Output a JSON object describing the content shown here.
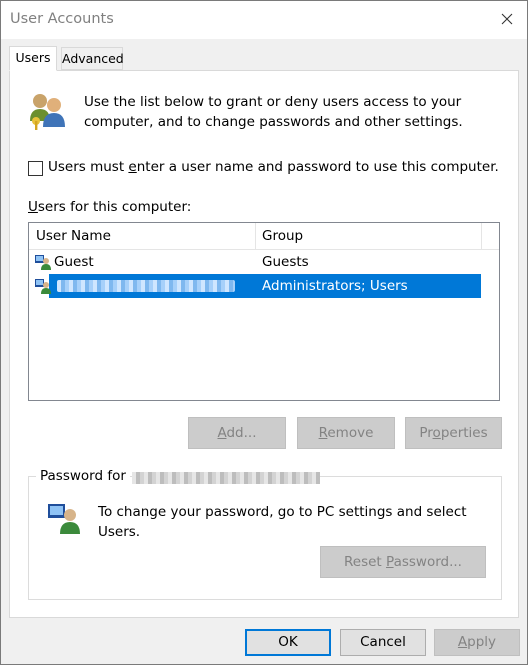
{
  "window": {
    "title": "User Accounts",
    "close_icon": "close-icon"
  },
  "tabs": [
    {
      "label": "Users"
    },
    {
      "label": "Advanced"
    }
  ],
  "users_tab": {
    "intro": "Use the list below to grant or deny users access to your computer, and to change passwords and other settings.",
    "require_login_checkbox": {
      "label": "Users must enter a user name and password to use this computer.",
      "checked": false
    },
    "list_label": "Users for this computer:",
    "columns": {
      "user_name": "User Name",
      "group": "Group"
    },
    "users": [
      {
        "name": "Guest",
        "group": "Guests",
        "selected": false
      },
      {
        "name": "",
        "group": "Administrators; Users",
        "selected": true
      }
    ],
    "buttons": {
      "add": "Add...",
      "remove": "Remove",
      "properties": "Properties"
    },
    "password_group": {
      "legend": "Password for",
      "text": "To change your password, go to PC settings and select Users.",
      "reset_button": "Reset Password..."
    }
  },
  "footer": {
    "ok": "OK",
    "cancel": "Cancel",
    "apply": "Apply"
  }
}
